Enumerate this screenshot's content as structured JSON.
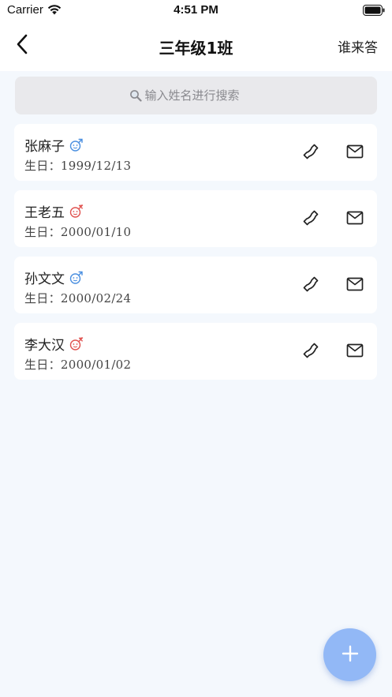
{
  "status_bar": {
    "carrier": "Carrier",
    "time": "4:51 PM"
  },
  "nav": {
    "title": "三年级1班",
    "action_label": "谁来答"
  },
  "search": {
    "placeholder": "输入姓名进行搜索"
  },
  "students": [
    {
      "name": "张麻子",
      "gender": "male",
      "birthday_label": "生日：",
      "birthday": "1999/12/13"
    },
    {
      "name": "王老五",
      "gender": "female",
      "birthday_label": "生日：",
      "birthday": "2000/01/10"
    },
    {
      "name": "孙文文",
      "gender": "male",
      "birthday_label": "生日：",
      "birthday": "2000/02/24"
    },
    {
      "name": "李大汉",
      "gender": "female",
      "birthday_label": "生日：",
      "birthday": "2000/01/02"
    }
  ],
  "colors": {
    "male": "#4a8fe0",
    "female": "#e0524f",
    "fab": "#92b8f6"
  },
  "icons": {
    "back": "chevron-left-icon",
    "search": "search-icon",
    "phone": "phone-icon",
    "mail": "mail-icon",
    "add": "plus-icon",
    "male": "male-icon",
    "female": "female-icon"
  }
}
